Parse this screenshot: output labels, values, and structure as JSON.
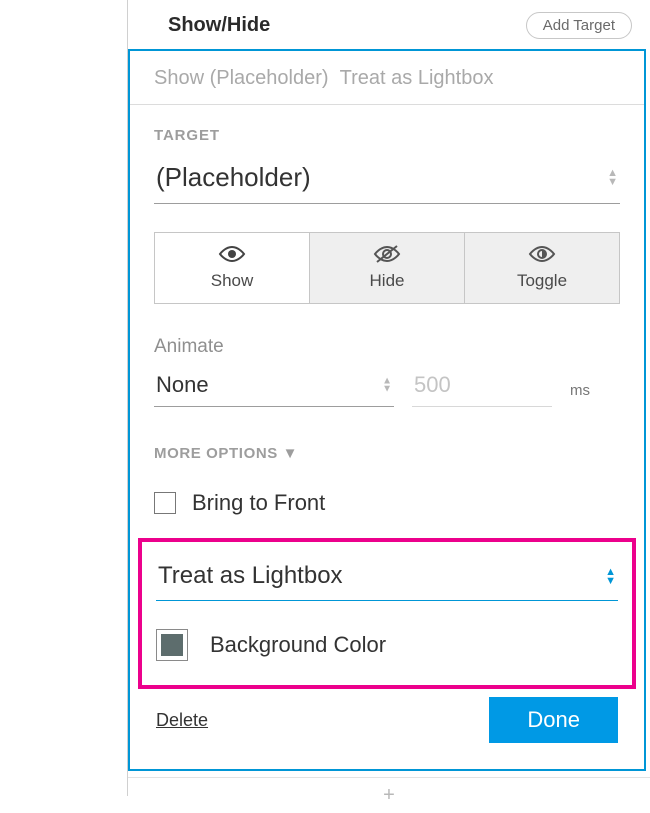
{
  "header": {
    "title": "Show/Hide",
    "add_target": "Add Target"
  },
  "crumb": {
    "left": "Show (Placeholder)",
    "right": "Treat as Lightbox"
  },
  "target": {
    "label": "TARGET",
    "value": "(Placeholder)"
  },
  "visibility": {
    "show": "Show",
    "hide": "Hide",
    "toggle": "Toggle"
  },
  "animate": {
    "label": "Animate",
    "value": "None",
    "duration": "500",
    "ms": "ms"
  },
  "more_options_label": "MORE OPTIONS ▼",
  "bring_to_front": "Bring to Front",
  "lightbox": {
    "value": "Treat as Lightbox",
    "bg_label": "Background Color",
    "bg_color": "#5d6d6d"
  },
  "footer": {
    "delete": "Delete",
    "done": "Done"
  },
  "plus": "+"
}
